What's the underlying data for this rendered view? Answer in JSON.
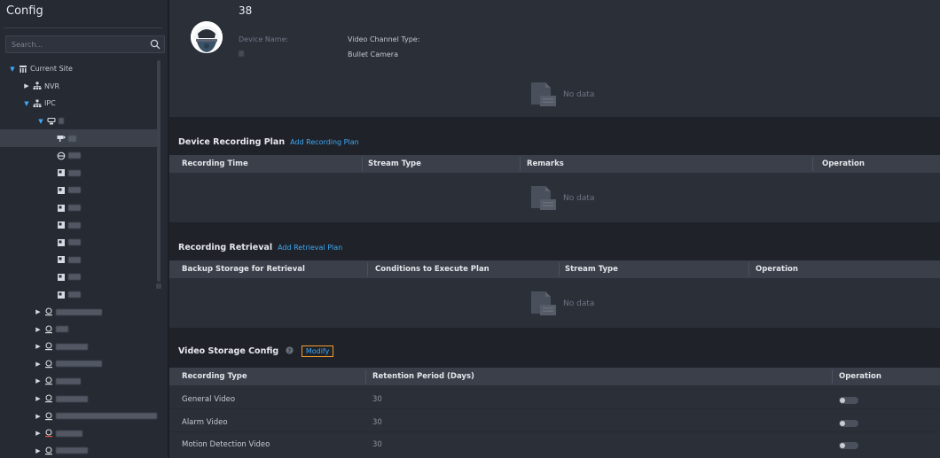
{
  "sidebar": {
    "title": "Config",
    "search_placeholder": "Search...",
    "tree": [
      {
        "label": "Current Site",
        "level": 0,
        "caret": "open",
        "icon": "site-icon"
      },
      {
        "label": "NVR",
        "level": 1,
        "caret": "closed",
        "icon": "network-icon"
      },
      {
        "label": "IPC",
        "level": 1,
        "caret": "open",
        "icon": "network-icon"
      }
    ]
  },
  "header": {
    "device_number": "38",
    "device_name_label": "Device Name:",
    "channel_type_label": "Video Channel Type:",
    "channel_type_value": "Bullet Camera"
  },
  "top_panel": {
    "no_data": "No data"
  },
  "recording_plan": {
    "title": "Device Recording Plan",
    "action": "Add Recording Plan",
    "columns": [
      "Recording Time",
      "Stream Type",
      "Remarks",
      "Operation"
    ],
    "no_data": "No data"
  },
  "retrieval": {
    "title": "Recording Retrieval",
    "action": "Add Retrieval Plan",
    "columns": [
      "Backup Storage for Retrieval",
      "Conditions to Execute Plan",
      "Stream Type",
      "Operation"
    ],
    "no_data": "No data"
  },
  "storage": {
    "title": "Video Storage Config",
    "action": "Modify",
    "columns": [
      "Recording Type",
      "Retention Period (Days)",
      "Operation"
    ],
    "rows": [
      {
        "type": "General Video",
        "days": "30",
        "enabled": false
      },
      {
        "type": "Alarm Video",
        "days": "30",
        "enabled": false
      },
      {
        "type": "Motion Detection Video",
        "days": "30",
        "enabled": false
      }
    ]
  },
  "colors": {
    "accent": "#3fa9f5",
    "highlight_border": "#f39c2b",
    "panel": "#2a2f38",
    "table_header": "#3a3f4a"
  }
}
